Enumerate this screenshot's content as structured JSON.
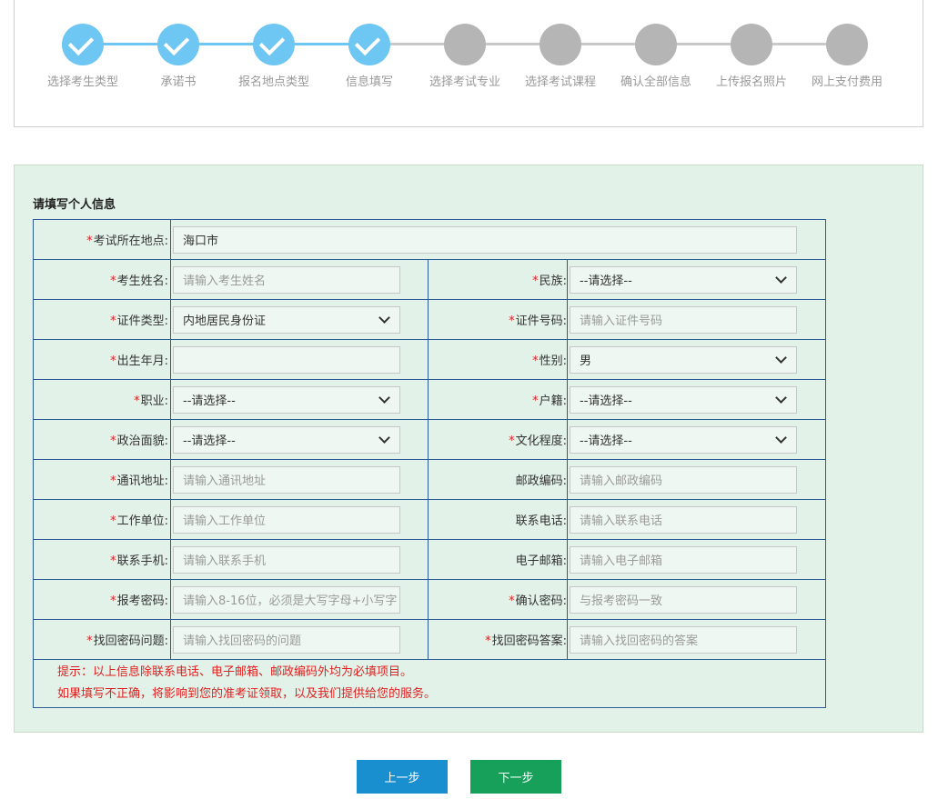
{
  "steps": [
    {
      "label": "选择考生类型",
      "status": "done"
    },
    {
      "label": "承诺书",
      "status": "done"
    },
    {
      "label": "报名地点类型",
      "status": "done"
    },
    {
      "label": "信息填写",
      "status": "done"
    },
    {
      "label": "选择考试专业",
      "status": "pending"
    },
    {
      "label": "选择考试课程",
      "status": "pending"
    },
    {
      "label": "确认全部信息",
      "status": "pending"
    },
    {
      "label": "上传报名照片",
      "status": "pending"
    },
    {
      "label": "网上支付费用",
      "status": "pending"
    }
  ],
  "colors": {
    "done": "#6ec6f3",
    "pending": "#b5b5b5",
    "panel_bg": "#e3f2e8",
    "border": "#2e5a9a",
    "required": "#e02020",
    "prev_btn": "#1a8fd0",
    "next_btn": "#16a05a"
  },
  "form": {
    "title": "请填写个人信息",
    "required_mark": "*",
    "exam_location": {
      "label": "考试所在地点:",
      "value": "海口市"
    },
    "name": {
      "label": "考生姓名:",
      "placeholder": "请输入考生姓名"
    },
    "ethnicity": {
      "label": "民族:",
      "value": "--请选择--"
    },
    "id_type": {
      "label": "证件类型:",
      "value": "内地居民身份证"
    },
    "id_number": {
      "label": "证件号码:",
      "placeholder": "请输入证件号码"
    },
    "birth": {
      "label": "出生年月:",
      "value": ""
    },
    "gender": {
      "label": "性别:",
      "value": "男"
    },
    "occupation": {
      "label": "职业:",
      "value": "--请选择--"
    },
    "household": {
      "label": "户籍:",
      "value": "--请选择--"
    },
    "political": {
      "label": "政治面貌:",
      "value": "--请选择--"
    },
    "education": {
      "label": "文化程度:",
      "value": "--请选择--"
    },
    "address": {
      "label": "通讯地址:",
      "placeholder": "请输入通讯地址"
    },
    "postcode": {
      "label": "邮政编码:",
      "placeholder": "请输入邮政编码"
    },
    "work_unit": {
      "label": "工作单位:",
      "placeholder": "请输入工作单位"
    },
    "phone": {
      "label": "联系电话:",
      "placeholder": "请输入联系电话"
    },
    "mobile": {
      "label": "联系手机:",
      "placeholder": "请输入联系手机"
    },
    "email": {
      "label": "电子邮箱:",
      "placeholder": "请输入电子邮箱"
    },
    "password": {
      "label": "报考密码:",
      "placeholder": "请输入8-16位，必须是大写字母+小写字"
    },
    "confirm_password": {
      "label": "确认密码:",
      "placeholder": "与报考密码一致"
    },
    "recovery_question": {
      "label": "找回密码问题:",
      "placeholder": "请输入找回密码的问题"
    },
    "recovery_answer": {
      "label": "找回密码答案:",
      "placeholder": "请输入找回密码的答案"
    },
    "notes": [
      "提示：以上信息除联系电话、电子邮箱、邮政编码外均为必填项目。",
      "如果填写不正确，将影响到您的准考证领取，以及我们提供给您的服务。"
    ]
  },
  "buttons": {
    "prev": "上一步",
    "next": "下一步"
  }
}
